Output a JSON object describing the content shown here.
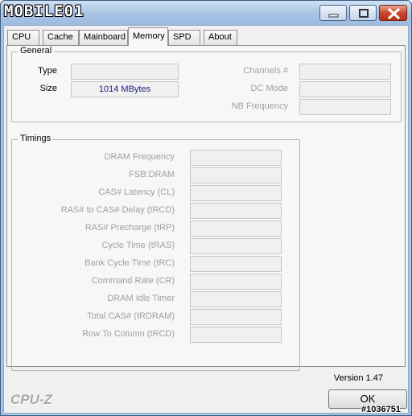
{
  "title_logo": "MOBILE01",
  "tabs": [
    "CPU",
    "Cache",
    "Mainboard",
    "Memory",
    "SPD",
    "About"
  ],
  "active_tab": "Memory",
  "general": {
    "title": "General",
    "type_label": "Type",
    "type_value": "",
    "size_label": "Size",
    "size_value": "1014 MBytes",
    "channels_label": "Channels #",
    "channels_value": "",
    "dcmode_label": "DC Mode",
    "dcmode_value": "",
    "nbfreq_label": "NB Frequency",
    "nbfreq_value": ""
  },
  "timings": {
    "title": "Timings",
    "rows": [
      {
        "label": "DRAM Frequency",
        "value": ""
      },
      {
        "label": "FSB:DRAM",
        "value": ""
      },
      {
        "label": "CAS# Latency (CL)",
        "value": ""
      },
      {
        "label": "RAS# to CAS# Delay (tRCD)",
        "value": ""
      },
      {
        "label": "RAS# Precharge (tRP)",
        "value": ""
      },
      {
        "label": "Cycle Time (tRAS)",
        "value": ""
      },
      {
        "label": "Bank Cycle Time (tRC)",
        "value": ""
      },
      {
        "label": "Command Rate (CR)",
        "value": ""
      },
      {
        "label": "DRAM Idle Timer",
        "value": ""
      },
      {
        "label": "Total CAS# (tRDRAM)",
        "value": ""
      },
      {
        "label": "Row To Column (tRCD)",
        "value": ""
      }
    ]
  },
  "version": "Version 1.47",
  "brand": "CPU-Z",
  "ok_label": "OK",
  "watermark": "#1036751",
  "colors": {
    "title_bar": "#a9c5e6",
    "close_button": "#c8482f",
    "value_text": "#1b1b8a",
    "disabled_text": "#a0a0a0"
  }
}
